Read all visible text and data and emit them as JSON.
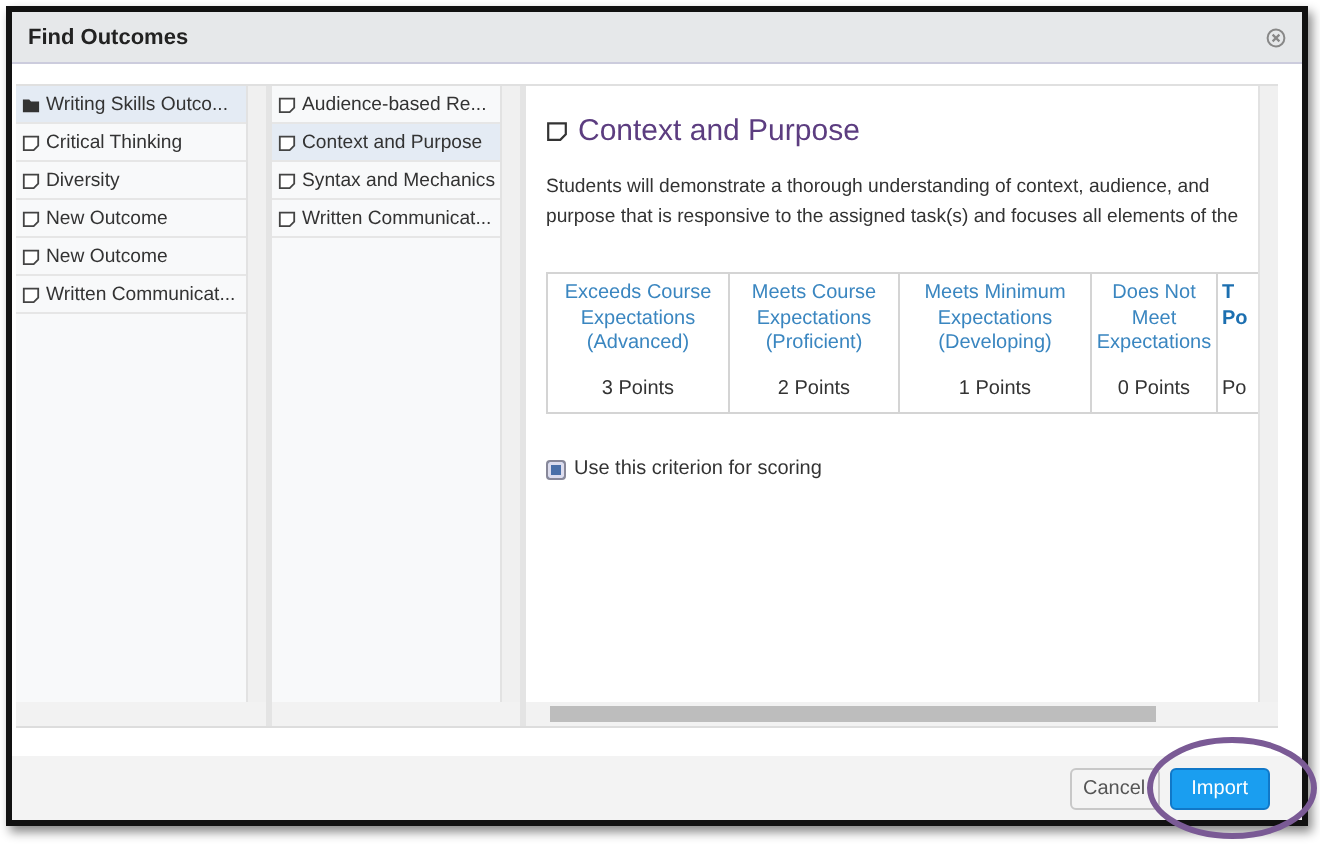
{
  "window": {
    "title": "Find Outcomes"
  },
  "outcome_sets": [
    {
      "label": "Writing Skills Outco...",
      "kind": "folder",
      "selected": true
    },
    {
      "label": "Critical Thinking",
      "kind": "outcome",
      "selected": false
    },
    {
      "label": "Diversity",
      "kind": "outcome",
      "selected": false
    },
    {
      "label": "New Outcome",
      "kind": "outcome",
      "selected": false
    },
    {
      "label": "New Outcome",
      "kind": "outcome",
      "selected": false
    },
    {
      "label": "Written Communicat...",
      "kind": "outcome",
      "selected": false
    }
  ],
  "criteria": [
    {
      "label": "Audience-based Re...",
      "selected": false
    },
    {
      "label": "Context and Purpose",
      "selected": true
    },
    {
      "label": "Syntax and Mechanics",
      "selected": false
    },
    {
      "label": "Written Communicat...",
      "selected": false
    }
  ],
  "detail": {
    "title": "Context and Purpose",
    "description": "Students will demonstrate a thorough understanding of context, audience, and purpose that is responsive to the assigned task(s) and focuses all elements of the",
    "levels": [
      {
        "name": "Exceeds Course Expectations (Advanced)",
        "points": "3 Points"
      },
      {
        "name": "Meets Course Expectations (Proficient)",
        "points": "2 Points"
      },
      {
        "name": "Meets Minimum Expectations (Developing)",
        "points": "1 Points"
      },
      {
        "name": "Does Not Meet Expectations",
        "points": "0 Points"
      },
      {
        "name": "T Po",
        "points": "Po"
      }
    ],
    "use_for_scoring": {
      "label": "Use this criterion for scoring",
      "checked": true
    }
  },
  "buttons": [
    {
      "label": "Cancel",
      "kind": "secondary"
    },
    {
      "label": "Import",
      "kind": "primary"
    }
  ]
}
